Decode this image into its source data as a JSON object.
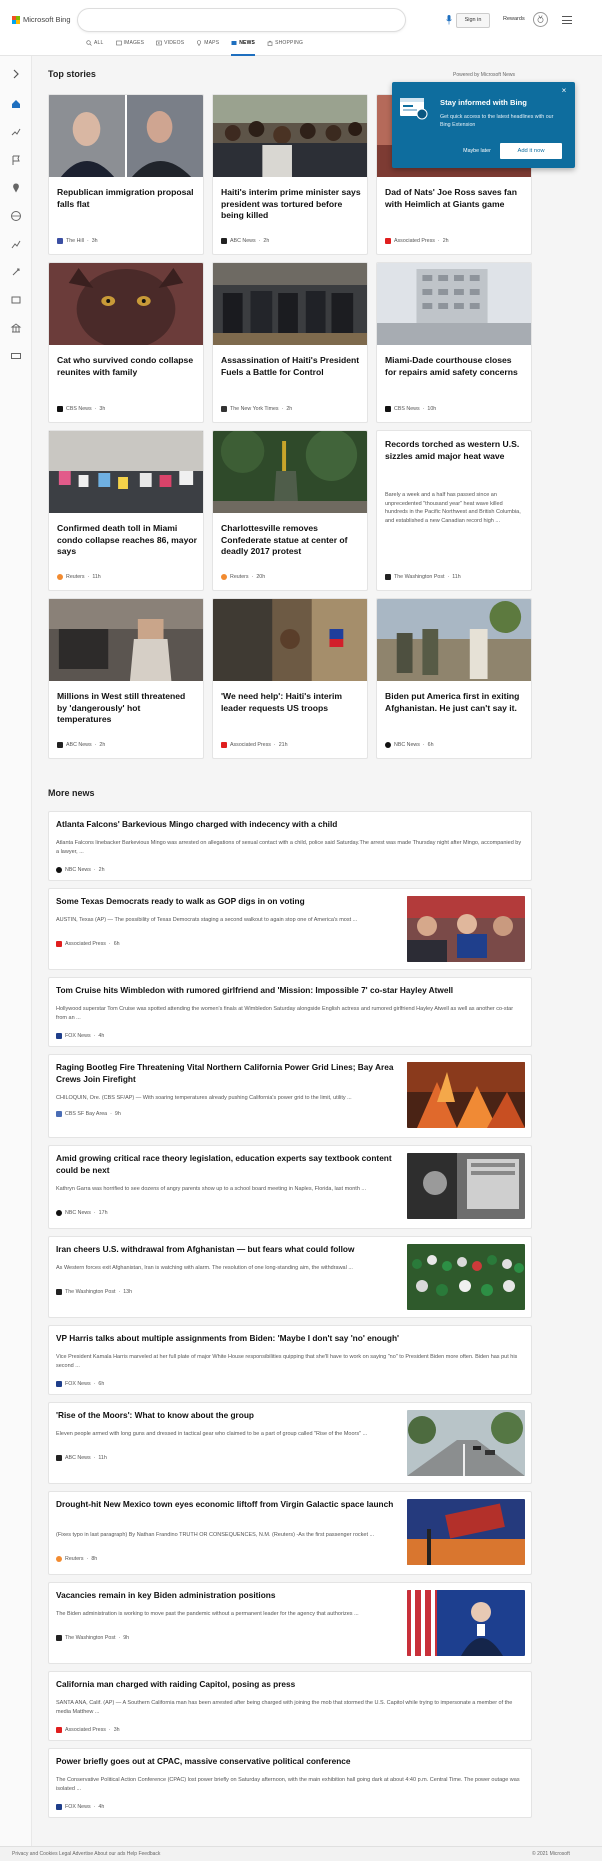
{
  "header": {
    "logo_text": "Microsoft Bing",
    "search_placeholder": "",
    "sign_in": "Sign in",
    "rewards": "Rewards",
    "tabs": [
      "ALL",
      "IMAGES",
      "VIDEOS",
      "MAPS",
      "NEWS",
      "SHOPPING"
    ],
    "active_tab": "NEWS",
    "brand_colors": [
      "#f25022",
      "#7fba00",
      "#00a4ef",
      "#ffb900"
    ]
  },
  "rail_icons": [
    "expand-icon",
    "home-icon",
    "trending-icon",
    "flag-icon",
    "location-icon",
    "globe-icon",
    "business-icon",
    "science-icon",
    "entertainment-icon",
    "politics-icon",
    "money-icon"
  ],
  "top_stories": {
    "title": "Top stories",
    "powered_by": "Powered by Microsoft News",
    "cards": [
      {
        "title": "Republican immigration proposal falls flat",
        "source": "The Hill",
        "age": "3h",
        "src_color": "#3b4fa3",
        "img": "politicians"
      },
      {
        "title": "Haiti's interim prime minister says president was tortured before being killed",
        "source": "ABC News",
        "age": "2h",
        "src_color": "#222222",
        "img": "crowd"
      },
      {
        "title": "Dad of Nats' Joe Ross saves fan with Heimlich at Giants game",
        "source": "Associated Press",
        "age": "2h",
        "src_color": "#e01e1e",
        "img": "stadium"
      },
      {
        "title": "Cat who survived condo collapse reunites with family",
        "source": "CBS News",
        "age": "3h",
        "src_color": "#111111",
        "img": "cat"
      },
      {
        "title": "Assassination of Haiti's President Fuels a Battle for Control",
        "source": "The New York Times",
        "age": "2h",
        "src_color": "#333333",
        "img": "officials"
      },
      {
        "title": "Miami-Dade courthouse closes for repairs amid safety concerns",
        "source": "CBS News",
        "age": "10h",
        "src_color": "#111111",
        "img": "building"
      },
      {
        "title": "Confirmed death toll in Miami condo collapse reaches 86, mayor says",
        "source": "Reuters",
        "age": "11h",
        "src_color": "#f28b30",
        "img": "memorial"
      },
      {
        "title": "Charlottesville removes Confederate statue at center of deadly 2017 protest",
        "source": "Reuters",
        "age": "20h",
        "src_color": "#f28b30",
        "img": "statue"
      },
      {
        "title": "Records torched as western U.S. sizzles amid major heat wave",
        "snippet": "Barely a week and a half has passed since an unprecedented \"thousand year\" heat wave killed hundreds in the Pacific Northwest and British Columbia, and established a new Canadian record high ...",
        "source": "The Washington Post",
        "age": "11h",
        "src_color": "#222222"
      },
      {
        "title": "Millions in West still threatened by 'dangerously' hot temperatures",
        "source": "ABC News",
        "age": "2h",
        "src_color": "#222222",
        "img": "heat"
      },
      {
        "title": "'We need help': Haiti's interim leader requests US troops",
        "source": "Associated Press",
        "age": "21h",
        "src_color": "#e01e1e",
        "img": "soldier"
      },
      {
        "title": "Biden put America first in exiting Afghanistan. He just can't say it.",
        "source": "NBC News",
        "age": "6h",
        "src_color": "#111111",
        "img": "troops"
      }
    ]
  },
  "popup": {
    "title": "Stay informed with Bing",
    "description": "Get quick access to the latest headlines with our Bing Extension",
    "maybe_later": "Maybe later",
    "add_it": "Add it now",
    "close": "×"
  },
  "more_news": {
    "title": "More news",
    "items": [
      {
        "title": "Atlanta Falcons' Barkevious Mingo charged with indecency with a child",
        "snippet": "Atlanta Falcons linebacker Barkevious Mingo was arrested on allegations of sexual contact with a child, police said Saturday.The arrest was made Thursday night after Mingo, accompanied by a lawyer, ...",
        "source": "NBC News",
        "age": "2h",
        "src_color": "#111111",
        "thumb": ""
      },
      {
        "title": "Some Texas Democrats ready to walk as GOP digs in on voting",
        "snippet": "AUSTIN, Texas (AP) — The possibility of Texas Democrats staging a second walkout to again stop one of America's most ...",
        "source": "Associated Press",
        "age": "6h",
        "src_color": "#e01e1e",
        "thumb": "rally"
      },
      {
        "title": "Tom Cruise hits Wimbledon with rumored girlfriend and 'Mission: Impossible 7' co-star Hayley Atwell",
        "snippet": "Hollywood superstar Tom Cruise was spotted attending the women's finals at Wimbledon Saturday alongside English actress and rumored girlfriend Hayley Atwell as well as another co-star from an ...",
        "source": "FOX News",
        "age": "4h",
        "src_color": "#1f3e8a",
        "thumb": ""
      },
      {
        "title": "Raging Bootleg Fire Threatening Vital Northern California Power Grid Lines; Bay Area Crews Join Firefight",
        "snippet": "CHILOQUIN, Ore. (CBS SF/AP) — With soaring temperatures already pushing California's power grid to the limit, utility ...",
        "source": "CBS SF Bay Area",
        "age": "9h",
        "src_color": "#4a6db5",
        "thumb": "fire"
      },
      {
        "title": "Amid growing critical race theory legislation, education experts say textbook content could be next",
        "snippet": "Kathryn Garra was horrified to see dozens of angry parents show up to a school board meeting in Naples, Florida, last month ...",
        "source": "NBC News",
        "age": "17h",
        "src_color": "#111111",
        "thumb": "bw"
      },
      {
        "title": "Iran cheers U.S. withdrawal from Afghanistan — but fears what could follow",
        "snippet": "As Western forces exit Afghanistan, Iran is watching with alarm. The resolution of one long-standing aim, the withdrawal ...",
        "source": "The Washington Post",
        "age": "13h",
        "src_color": "#222222",
        "thumb": "crowd"
      },
      {
        "title": "VP Harris talks about multiple assignments from Biden: 'Maybe I don't say 'no' enough'",
        "snippet": "Vice President Kamala Harris marveled at her full plate of major White House responsibilities quipping that she'll have to work on saying \"no\" to President Biden more often. Biden has put his second ...",
        "source": "FOX News",
        "age": "6h",
        "src_color": "#1f3e8a",
        "thumb": ""
      },
      {
        "title": "'Rise of the Moors': What to know about the group",
        "snippet": "Eleven people armed with long guns and dressed in tactical gear who claimed to be a part of group called \"Rise of the Moors\" ...",
        "source": "ABC News",
        "age": "11h",
        "src_color": "#222222",
        "thumb": "highway"
      },
      {
        "title": "Drought-hit New Mexico town eyes economic liftoff from Virgin Galactic space launch",
        "snippet": "(Fixes typo in last paragraph) By Nathan Frandino TRUTH OR CONSEQUENCES, N.M. (Reuters) -As the first passenger rocket ...",
        "source": "Reuters",
        "age": "8h",
        "src_color": "#f28b30",
        "thumb": "sign"
      },
      {
        "title": "Vacancies remain in key Biden administration positions",
        "snippet": "The Biden administration is working to move past the pandemic without a permanent leader for the agency that authorizes ...",
        "source": "The Washington Post",
        "age": "9h",
        "src_color": "#222222",
        "thumb": "biden"
      },
      {
        "title": "California man charged with raiding Capitol, posing as press",
        "snippet": "SANTA ANA, Calif. (AP) — A Southern California man has been arrested after being charged with joining the mob that stormed the U.S. Capitol while trying to impersonate a member of the media Matthew ...",
        "source": "Associated Press",
        "age": "3h",
        "src_color": "#e01e1e",
        "thumb": ""
      },
      {
        "title": "Power briefly goes out at CPAC, massive conservative political conference",
        "snippet": "The Conservative Political Action Conference (CPAC) lost power briefly on Saturday afternoon, with the main exhibition hall going dark at about 4:40 p.m. Central Time.  The power outage was isolated ...",
        "source": "FOX News",
        "age": "4h",
        "src_color": "#1f3e8a",
        "thumb": ""
      }
    ]
  },
  "footer": {
    "left": "Privacy and Cookies   Legal   Advertise   About our ads   Help   Feedback",
    "right": "© 2021 Microsoft"
  }
}
